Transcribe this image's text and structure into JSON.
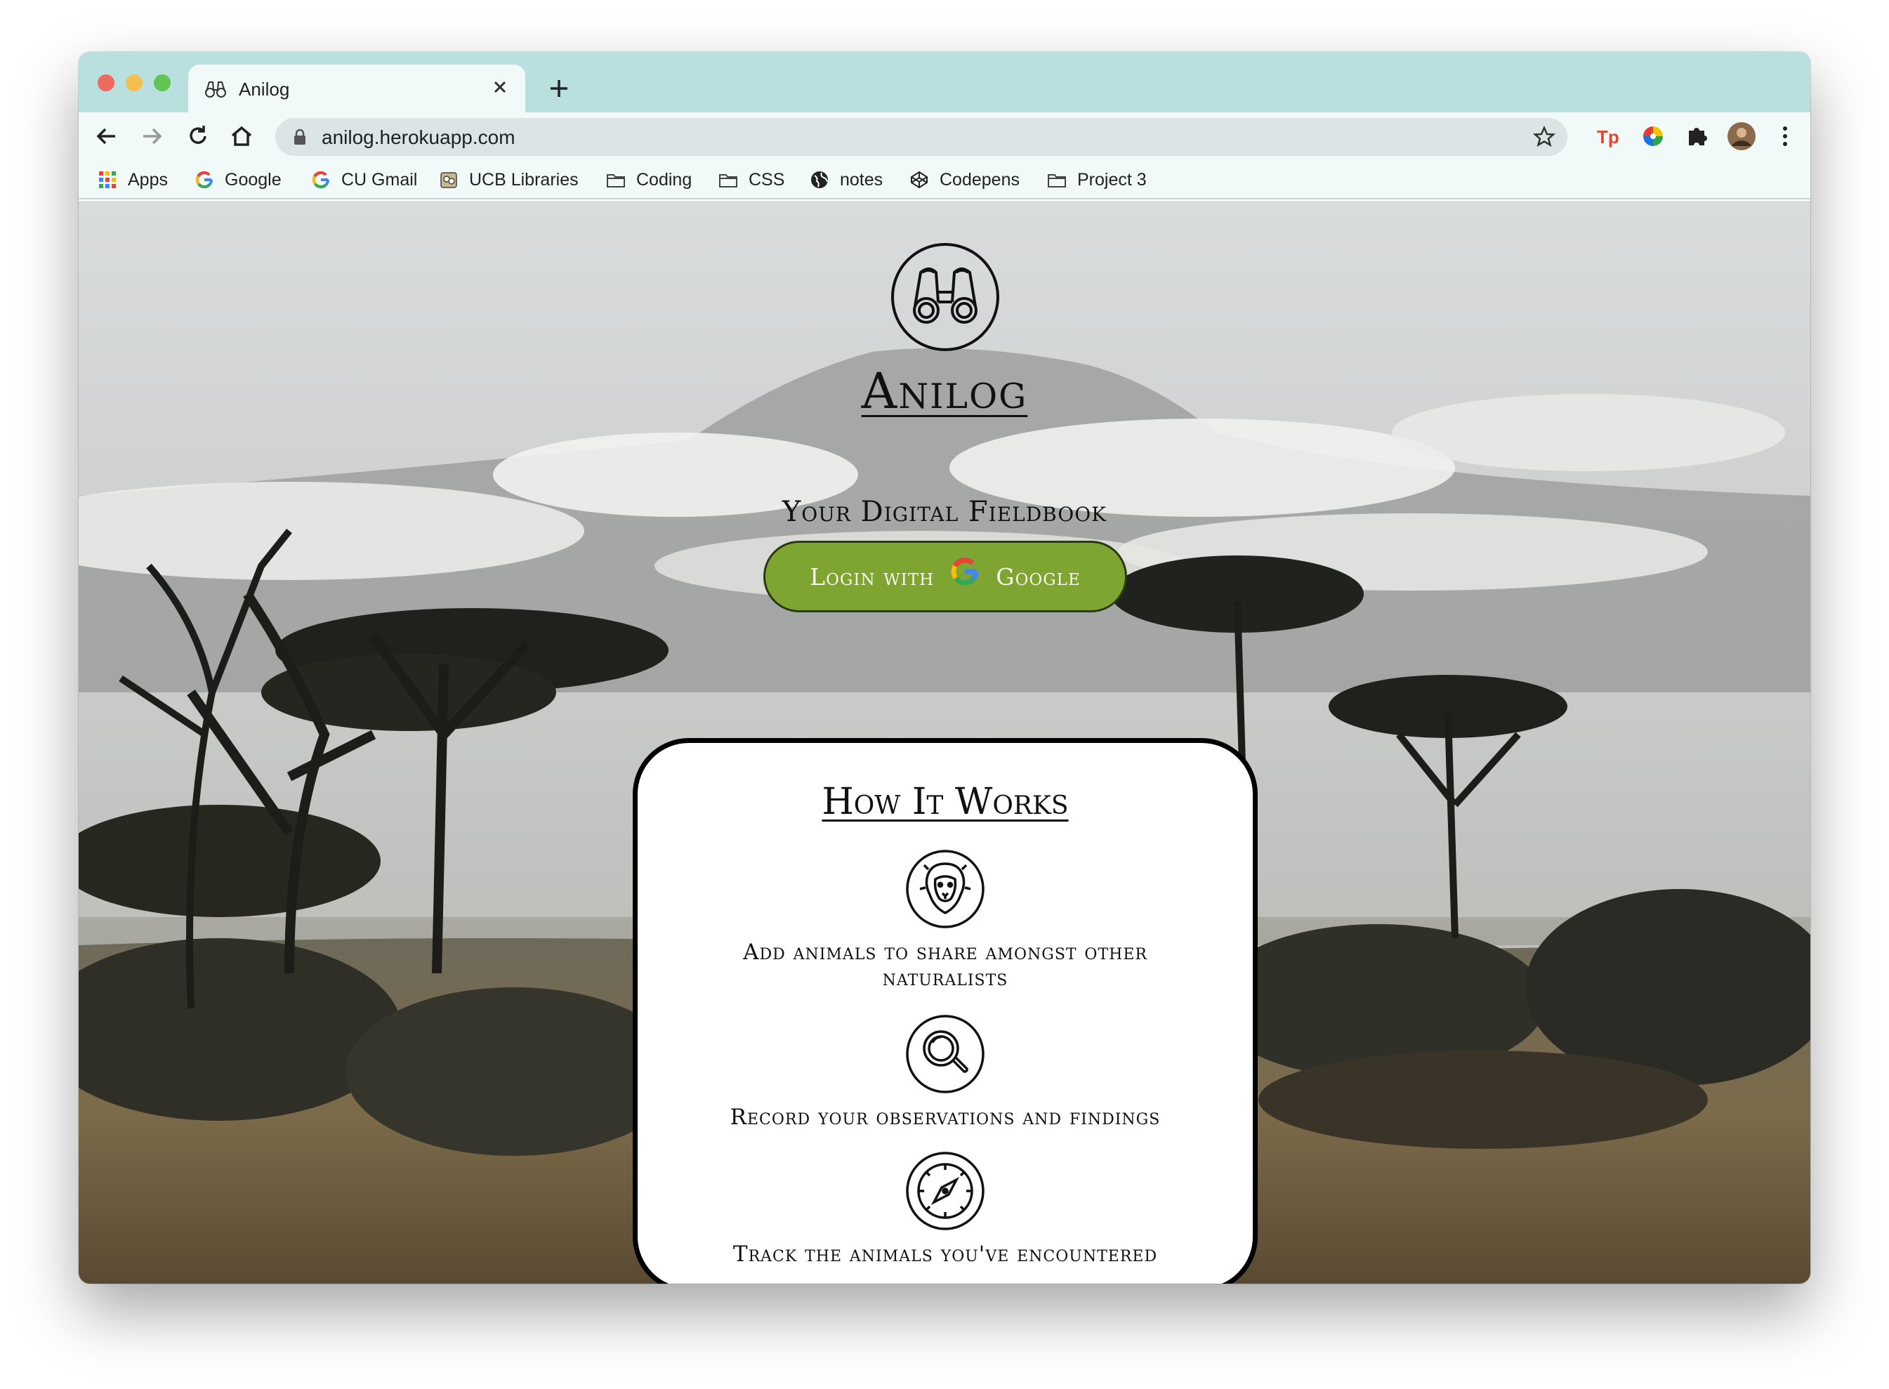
{
  "browser": {
    "tab": {
      "title": "Anilog",
      "favicon": "binoculars-icon"
    },
    "new_tab_icon": "plus-icon",
    "url": "anilog.herokuapp.com",
    "bookmarks": [
      {
        "label": "Apps",
        "icon": "apps-grid-icon"
      },
      {
        "label": "Google",
        "icon": "google-icon"
      },
      {
        "label": "CU Gmail",
        "icon": "google-icon"
      },
      {
        "label": "UCB Libraries",
        "icon": "library-icon"
      },
      {
        "label": "Coding",
        "icon": "folder-icon"
      },
      {
        "label": "CSS",
        "icon": "folder-icon"
      },
      {
        "label": "notes",
        "icon": "globe-icon"
      },
      {
        "label": "Codepens",
        "icon": "codepen-icon"
      },
      {
        "label": "Project 3",
        "icon": "folder-icon"
      }
    ],
    "extensions": [
      "tp-extension-icon",
      "color-wheel-icon",
      "puzzle-icon",
      "profile-avatar",
      "more-menu-icon"
    ]
  },
  "hero": {
    "logo_icon": "binoculars-icon",
    "brand": "Anilog",
    "tagline": "Your Digital Fieldbook",
    "login": {
      "prefix": "Login with",
      "suffix": "Google",
      "icon": "google-g-icon"
    }
  },
  "how_it_works": {
    "title": "How It Works",
    "steps": [
      {
        "icon": "lion-icon",
        "text": "Add animals to share amongst other naturalists"
      },
      {
        "icon": "magnifier-icon",
        "text": "Record your observations and findings"
      },
      {
        "icon": "compass-icon",
        "text": "Track the animals you've encountered"
      }
    ]
  },
  "colors": {
    "tab_strip": "#b9dfde",
    "toolbar": "#f1faf9",
    "login_button": "#7ea432",
    "card_border": "#000000"
  }
}
